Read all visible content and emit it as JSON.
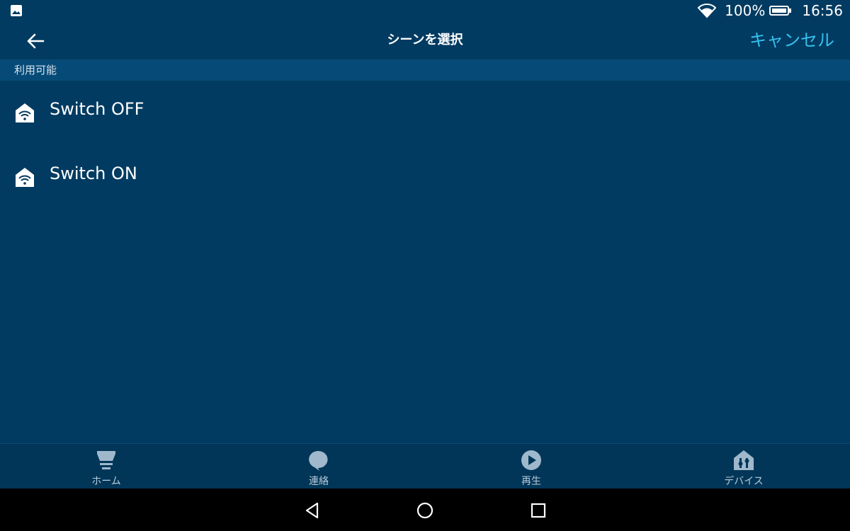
{
  "status_bar": {
    "battery_percent": "100%",
    "time": "16:56"
  },
  "header": {
    "title": "シーンを選択",
    "cancel_label": "キャンセル"
  },
  "section": {
    "label": "利用可能"
  },
  "scenes": [
    {
      "label": "Switch OFF",
      "icon": "scene-home-wifi-icon"
    },
    {
      "label": "Switch ON",
      "icon": "scene-home-wifi-icon"
    }
  ],
  "bottom_nav": {
    "items": [
      {
        "label": "ホーム",
        "icon": "home-icon"
      },
      {
        "label": "連絡",
        "icon": "chat-bubble-icon"
      },
      {
        "label": "再生",
        "icon": "play-icon"
      },
      {
        "label": "デバイス",
        "icon": "devices-icon"
      }
    ]
  },
  "colors": {
    "background": "#023b61",
    "section_header": "#064b77",
    "accent": "#37c0ee",
    "bottom_nav": "#013658"
  }
}
